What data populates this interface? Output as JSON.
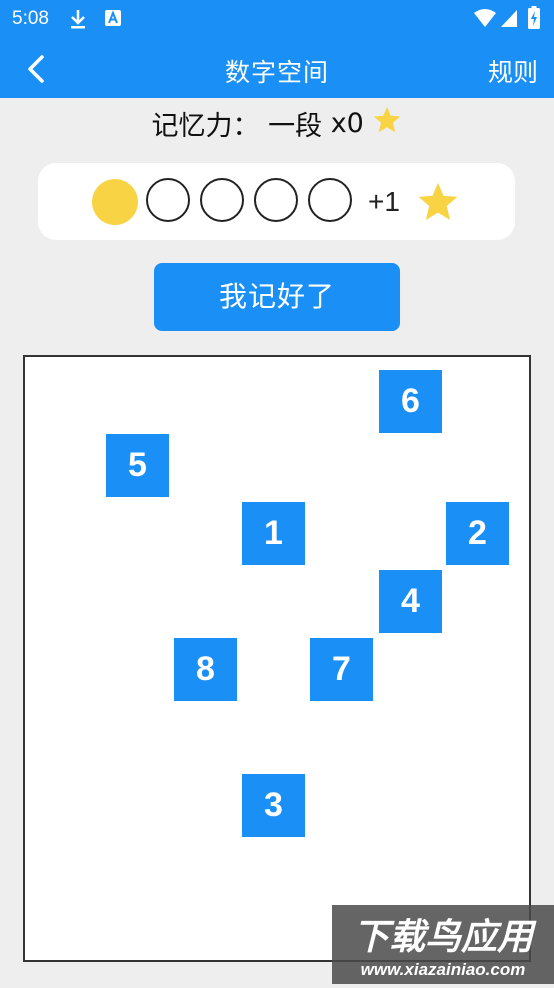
{
  "status_bar": {
    "time": "5:08",
    "icons": [
      "download-icon",
      "a-badge-icon",
      "wifi-icon",
      "signal-icon",
      "battery-charging-icon"
    ]
  },
  "app_bar": {
    "title": "数字空间",
    "rules_label": "规则",
    "back_icon": "chevron-left-icon"
  },
  "memory": {
    "label": "记忆力：",
    "rank": "一段",
    "star_count": "x0"
  },
  "progress": {
    "filled_count": 1,
    "total_count": 5,
    "reward_label": "+1"
  },
  "done_button": {
    "label": "我记好了"
  },
  "board": {
    "tiles": [
      {
        "number": "6"
      },
      {
        "number": "5"
      },
      {
        "number": "1"
      },
      {
        "number": "2"
      },
      {
        "number": "4"
      },
      {
        "number": "8"
      },
      {
        "number": "7"
      },
      {
        "number": "3"
      }
    ]
  },
  "watermark": {
    "title": "下载鸟应用",
    "url": "www.xiazainiao.com"
  },
  "colors": {
    "primary": "#1a8ff5",
    "star": "#f8d445",
    "background": "#eeeeee"
  }
}
